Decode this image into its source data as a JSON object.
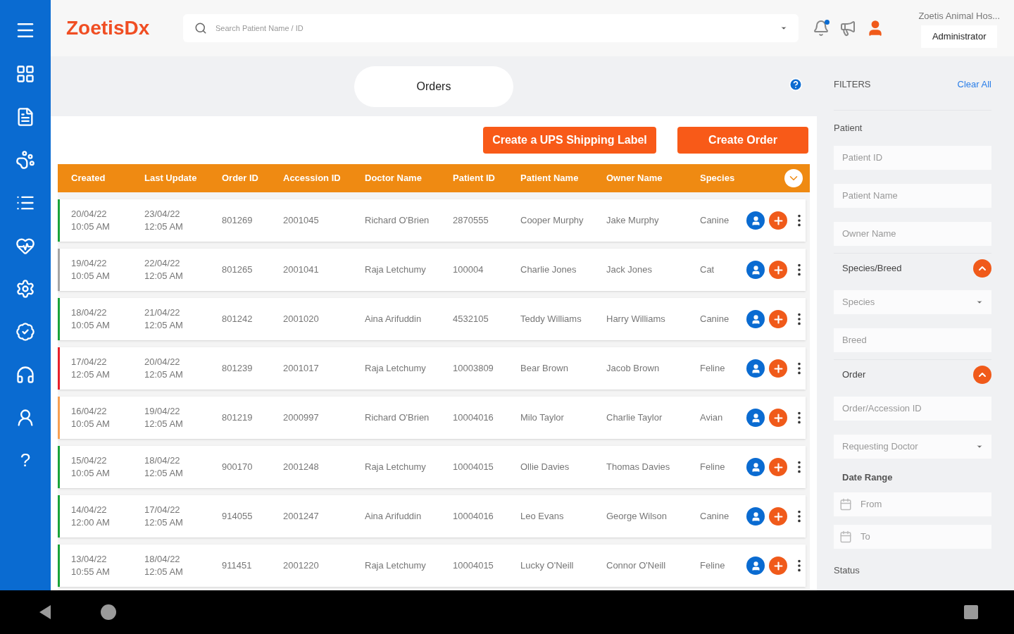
{
  "header": {
    "logo": "ZoetisDx",
    "search": {
      "placeholder": "Search Patient Name / ID"
    },
    "notifications_unread": true,
    "clinic": "Zoetis Animal Hos...",
    "role": "Administrator"
  },
  "sidebar": {
    "help": "?"
  },
  "page_tab": "Orders",
  "buttons": [
    "Create a UPS Shipping Label",
    "Create Order"
  ],
  "table": {
    "columns": [
      "Created",
      "Last Update",
      "Order ID",
      "Accession ID",
      "Doctor Name",
      "Patient ID",
      "Patient Name",
      "Owner Name",
      "Species"
    ],
    "rows": [
      {
        "color": "#1aa33a",
        "cells": [
          "20/04/22\n10:05 AM",
          "23/04/22\n12:05 AM",
          "801269",
          "2001045",
          "Richard O'Brien",
          "2870555",
          "Cooper Murphy",
          "Jake Murphy",
          "Canine"
        ]
      },
      {
        "color": "#a6a6a6",
        "cells": [
          "19/04/22\n10:05 AM",
          "22/04/22\n12:05 AM",
          "801265",
          "2001041",
          "Raja Letchumy",
          "100004",
          "Charlie Jones",
          "Jack Jones",
          "Cat"
        ]
      },
      {
        "color": "#1aa33a",
        "cells": [
          "18/04/22\n10:05 AM",
          "21/04/22\n12:05 AM",
          "801242",
          "2001020",
          "Aina Arifuddin",
          "4532105",
          "Teddy Williams",
          "Harry Williams",
          "Canine"
        ]
      },
      {
        "color": "#e8212b",
        "cells": [
          "17/04/22\n12:05 AM",
          "20/04/22\n12:05 AM",
          "801239",
          "2001017",
          "Raja Letchumy",
          "10003809",
          "Bear Brown",
          "Jacob Brown",
          "Feline"
        ]
      },
      {
        "color": "#f7a154",
        "cells": [
          "16/04/22\n10:05 AM",
          "19/04/22\n12:05 AM",
          "801219",
          "2000997",
          "Richard O'Brien",
          "10004016",
          "Milo Taylor",
          "Charlie Taylor",
          "Avian"
        ]
      },
      {
        "color": "#1aa33a",
        "cells": [
          "15/04/22\n10:05 AM",
          "18/04/22\n12:05 AM",
          "900170",
          "2001248",
          "Raja Letchumy",
          "10004015",
          "Ollie Davies",
          "Thomas Davies",
          "Feline"
        ]
      },
      {
        "color": "#1aa33a",
        "cells": [
          "14/04/22\n12:00 AM",
          "17/04/22\n12:05 AM",
          "914055",
          "2001247",
          "Aina Arifuddin",
          "10004016",
          "Leo Evans",
          "George Wilson",
          "Canine"
        ]
      },
      {
        "color": "#1aa33a",
        "cells": [
          "13/04/22\n10:55 AM",
          "18/04/22\n12:05 AM",
          "911451",
          "2001220",
          "Raja Letchumy",
          "10004015",
          "Lucky O'Neill",
          "Connor O'Neill",
          "Feline"
        ]
      }
    ]
  },
  "filters": {
    "title": "FILTERS",
    "clear": "Clear All",
    "items": [
      {
        "kind": "section",
        "label": "Patient"
      },
      {
        "kind": "field",
        "placeholder": "Patient ID"
      },
      {
        "kind": "field",
        "placeholder": "Patient Name"
      },
      {
        "kind": "field",
        "placeholder": "Owner Name"
      },
      {
        "kind": "group",
        "label": "Species/Breed",
        "expanded": true
      },
      {
        "kind": "select",
        "placeholder": "Species"
      },
      {
        "kind": "field",
        "placeholder": "Breed"
      },
      {
        "kind": "group",
        "label": "Order",
        "expanded": true
      },
      {
        "kind": "field",
        "placeholder": "Order/Accession ID"
      },
      {
        "kind": "select",
        "placeholder": "Requesting Doctor"
      },
      {
        "kind": "label",
        "label": "Date Range"
      },
      {
        "kind": "date",
        "placeholder": "From"
      },
      {
        "kind": "date",
        "placeholder": "To"
      },
      {
        "kind": "section",
        "label": "Status"
      }
    ]
  }
}
